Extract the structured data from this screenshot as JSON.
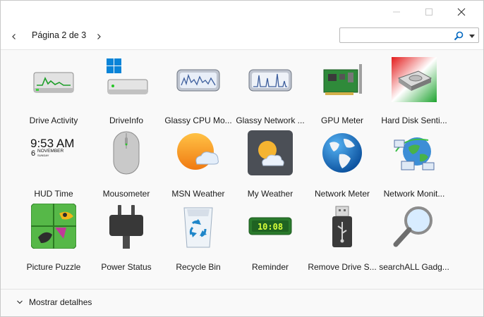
{
  "window": {
    "controls": {
      "minimize_icon": "minimize-icon",
      "maximize_icon": "maximize-icon",
      "close_icon": "close-icon"
    }
  },
  "toolbar": {
    "page_label": "Página 2 de 3",
    "search_value": "",
    "search_placeholder": ""
  },
  "gadgets": [
    {
      "label": "Drive Activity",
      "icon": "drive-activity-icon"
    },
    {
      "label": "DriveInfo",
      "icon": "drive-info-icon"
    },
    {
      "label": "Glassy CPU Mo...",
      "icon": "cpu-monitor-icon"
    },
    {
      "label": "Glassy Network ...",
      "icon": "network-monitor-icon"
    },
    {
      "label": "GPU Meter",
      "icon": "gpu-card-icon"
    },
    {
      "label": "Hard Disk Senti...",
      "icon": "hard-disk-icon"
    },
    {
      "label": "HUD Time",
      "icon": "clock-icon",
      "time": "9:53 AM",
      "day": "6",
      "month": "NOVEMBER",
      "weekday": "SUNDAY"
    },
    {
      "label": "Mousometer",
      "icon": "mouse-icon"
    },
    {
      "label": "MSN Weather",
      "icon": "weather-icon"
    },
    {
      "label": "My Weather",
      "icon": "weather-dark-icon"
    },
    {
      "label": "Network Meter",
      "icon": "globe-icon"
    },
    {
      "label": "Network Monit...",
      "icon": "network-globe-icon"
    },
    {
      "label": "Picture Puzzle",
      "icon": "puzzle-icon"
    },
    {
      "label": "Power Status",
      "icon": "power-plug-icon"
    },
    {
      "label": "Recycle Bin",
      "icon": "recycle-bin-icon"
    },
    {
      "label": "Reminder",
      "icon": "reminder-icon",
      "display": "10:08"
    },
    {
      "label": "Remove Drive S...",
      "icon": "usb-drive-icon"
    },
    {
      "label": "searchALL Gadg...",
      "icon": "magnifier-icon"
    }
  ],
  "footer": {
    "details_label": "Mostrar detalhes"
  },
  "colors": {
    "accent": "#0067c0",
    "window_bg": "#f9f9f9",
    "meter_green": "#2fbf2f"
  }
}
